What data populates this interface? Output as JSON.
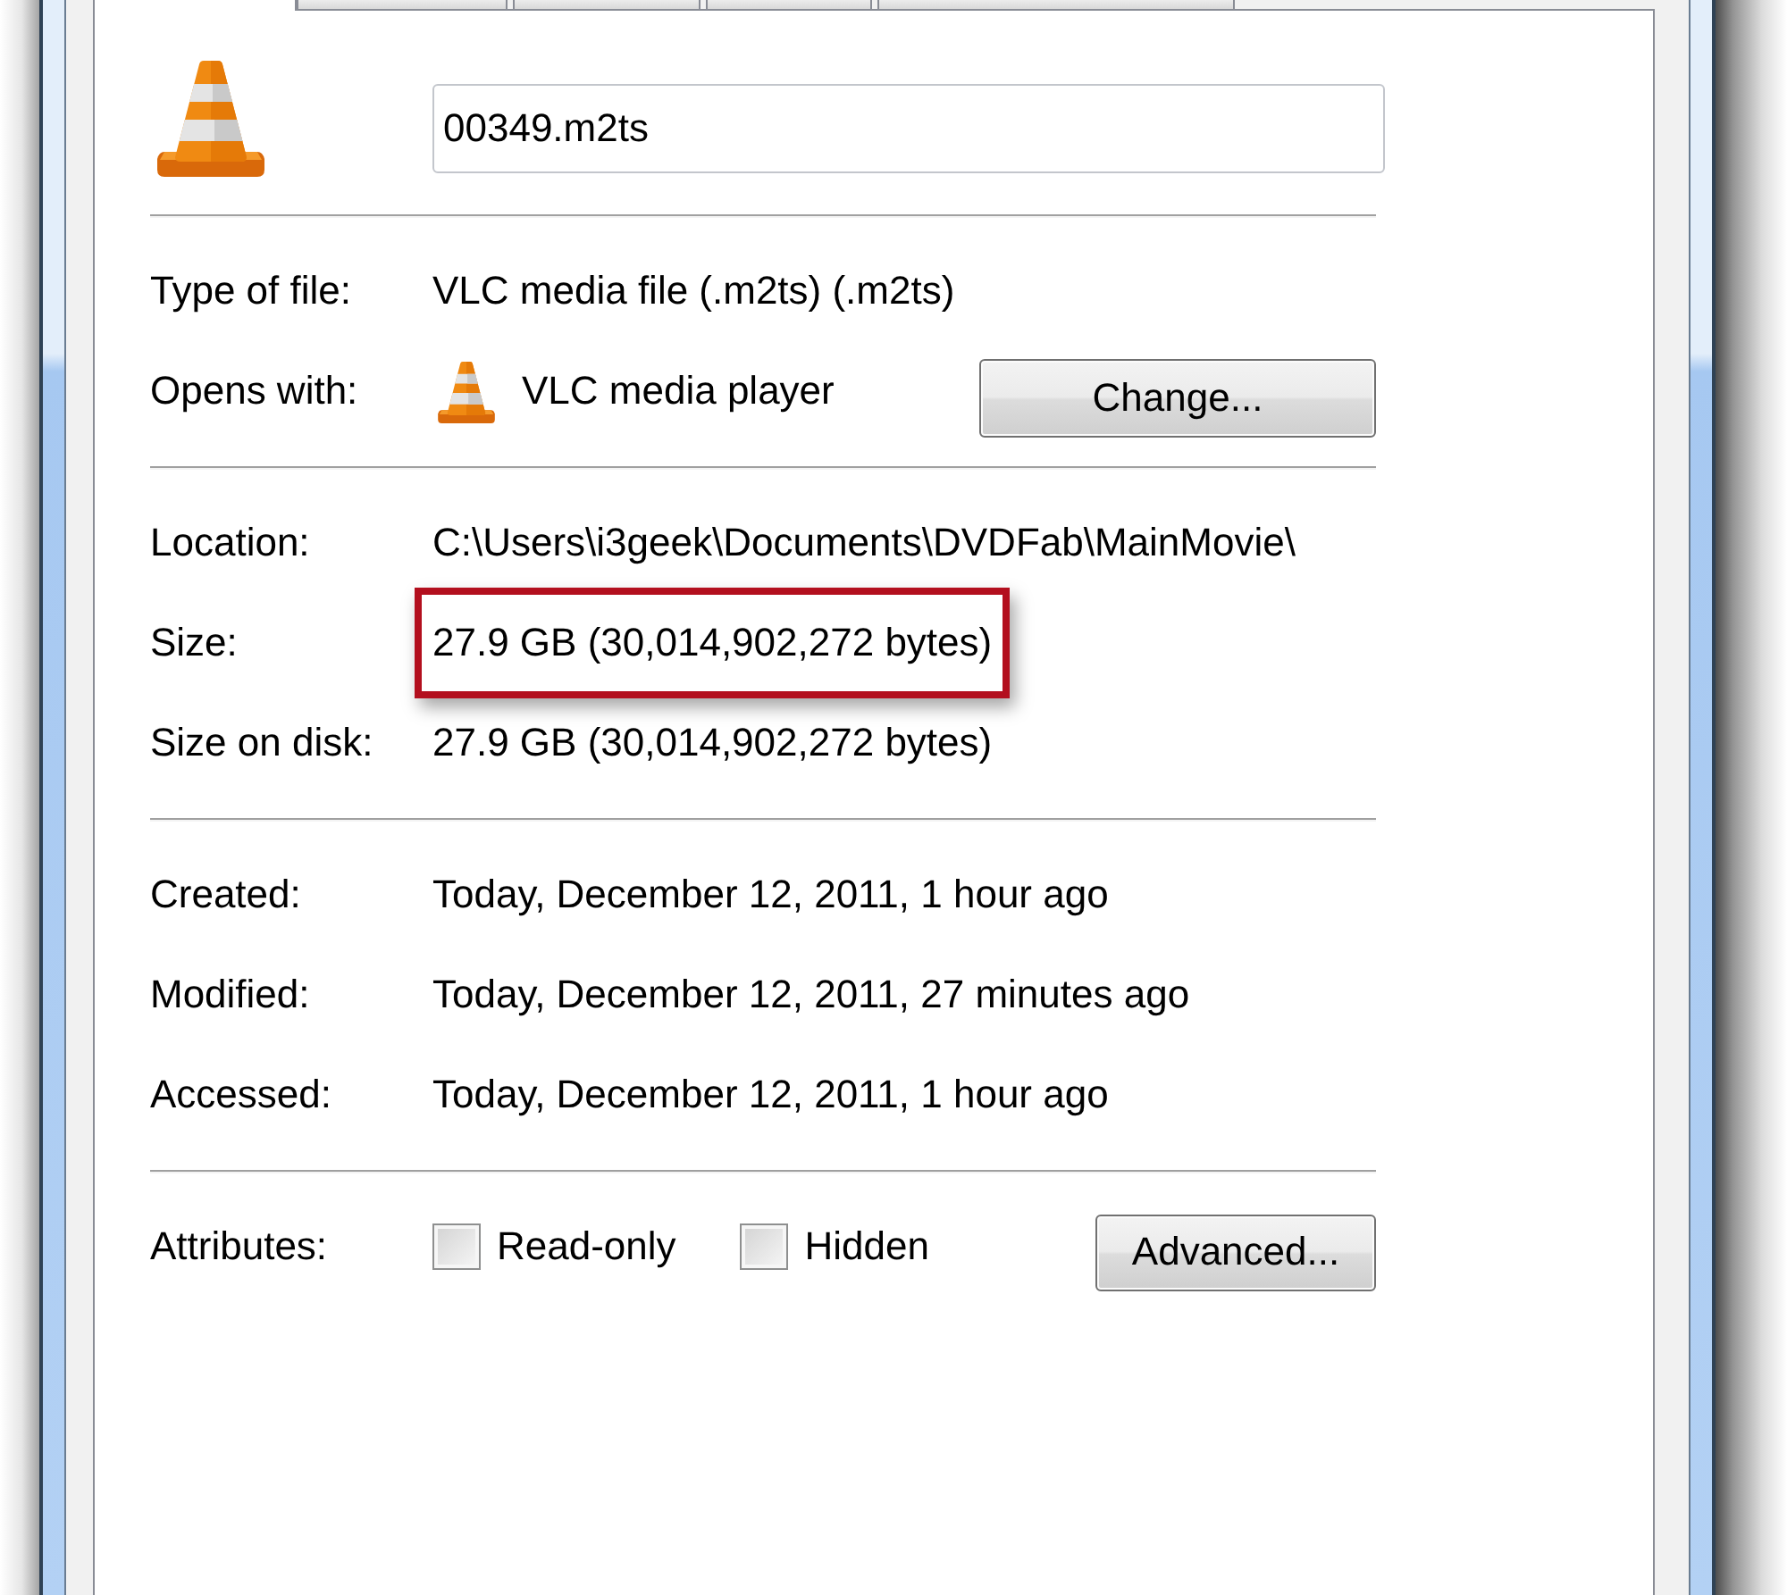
{
  "tabs": [
    {
      "selected": true
    },
    {
      "selected": false
    },
    {
      "selected": false
    },
    {
      "selected": false
    },
    {
      "selected": false
    }
  ],
  "file": {
    "name": "00349.m2ts"
  },
  "sections": [
    {
      "rows": [
        {
          "kind": "text",
          "label": "Type of file:",
          "value": "VLC media file (.m2ts) (.m2ts)",
          "highlighted": false
        },
        {
          "kind": "app",
          "label": "Opens with:",
          "value": "VLC media player",
          "button": "Change...",
          "highlighted": false
        }
      ]
    },
    {
      "rows": [
        {
          "kind": "text",
          "label": "Location:",
          "value": "C:\\Users\\i3geek\\Documents\\DVDFab\\MainMovie\\",
          "highlighted": false
        },
        {
          "kind": "text",
          "label": "Size:",
          "value": "27.9 GB (30,014,902,272 bytes)",
          "highlighted": true
        },
        {
          "kind": "text",
          "label": "Size on disk:",
          "value": "27.9 GB (30,014,902,272 bytes)",
          "highlighted": false
        }
      ]
    },
    {
      "rows": [
        {
          "kind": "text",
          "label": "Created:",
          "value": "Today, December 12, 2011, 1 hour ago",
          "highlighted": false
        },
        {
          "kind": "text",
          "label": "Modified:",
          "value": "Today, December 12, 2011, 27 minutes ago",
          "highlighted": false
        },
        {
          "kind": "text",
          "label": "Accessed:",
          "value": "Today, December 12, 2011, 1 hour ago",
          "highlighted": false
        }
      ]
    },
    {
      "rows": [
        {
          "kind": "attributes",
          "label": "Attributes:",
          "checkboxes": [
            {
              "label": "Read-only",
              "checked": false
            },
            {
              "label": "Hidden",
              "checked": false
            }
          ],
          "button": "Advanced...",
          "highlighted": false
        }
      ]
    }
  ]
}
